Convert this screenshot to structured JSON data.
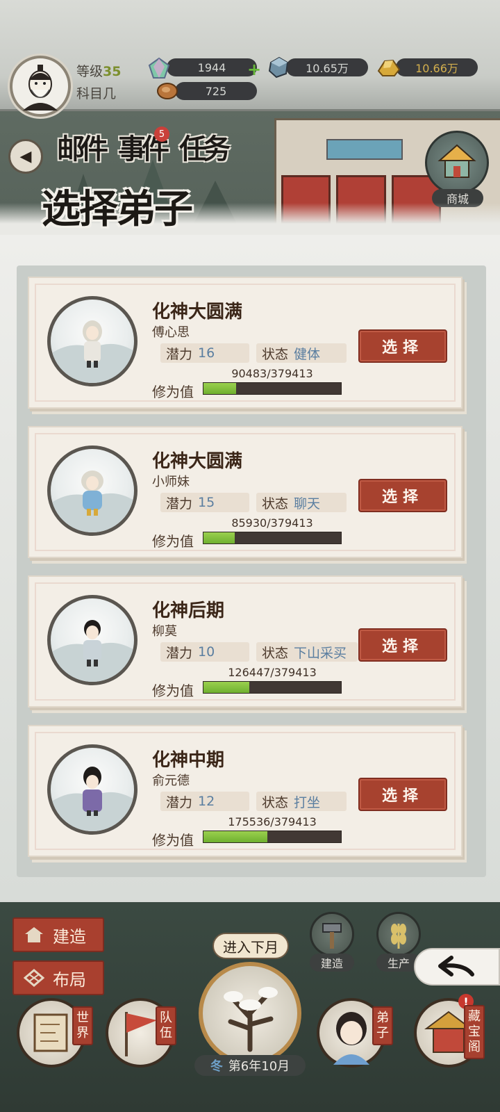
{
  "player": {
    "level_label": "等级",
    "level": "35",
    "name": "科目几"
  },
  "resources": {
    "crystal": "1944",
    "ore": "10.65万",
    "gold": "10.66万",
    "meat": "725"
  },
  "nav": {
    "mail": "邮件",
    "events": "事件",
    "events_badge": "5",
    "tasks": "任务",
    "shop": "商城"
  },
  "section_title": "选择弟子",
  "xp_label": "修为值",
  "potential_label": "潜力",
  "status_label": "状态",
  "select_label": "选择",
  "disciples": [
    {
      "realm": "化神大圆满",
      "name": "傅心思",
      "potential": "16",
      "status": "健体",
      "xp": "90483/379413",
      "progress": 0.238,
      "robe": "#e9e6df",
      "hair": "#dcd8cc"
    },
    {
      "realm": "化神大圆满",
      "name": "小师妹",
      "potential": "15",
      "status": "聊天",
      "xp": "85930/379413",
      "progress": 0.226,
      "robe": "#7fb1d6",
      "hair": "#dcd8cc"
    },
    {
      "realm": "化神后期",
      "name": "柳莫",
      "potential": "10",
      "status": "下山采买",
      "xp": "126447/379413",
      "progress": 0.333,
      "robe": "#c9d3d8",
      "hair": "#1f1c1a"
    },
    {
      "realm": "化神中期",
      "name": "俞元德",
      "potential": "12",
      "status": "打坐",
      "xp": "175536/379413",
      "progress": 0.463,
      "robe": "#7c6aa8",
      "hair": "#1f1c1a"
    }
  ],
  "bottom": {
    "build": "建造",
    "layout": "布局",
    "next_month": "进入下月",
    "build_small": "建造",
    "produce": "生产",
    "season": "冬",
    "date": "第6年10月",
    "world": "世界",
    "team": "队伍",
    "disciples": "弟子",
    "treasury": "藏宝阁",
    "alert": "!"
  }
}
